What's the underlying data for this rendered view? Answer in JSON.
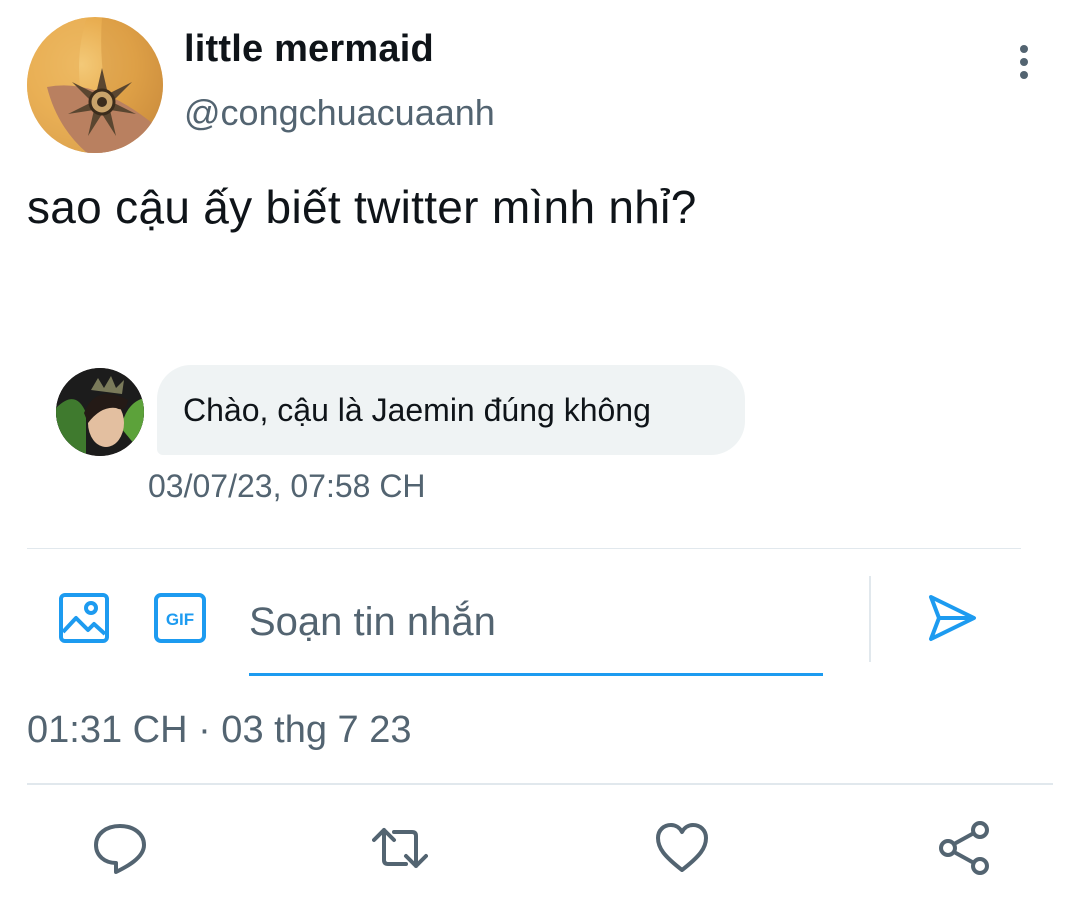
{
  "author": {
    "display_name": "little mermaid",
    "handle": "@congchuacuaanh",
    "avatar": "profile-photo"
  },
  "tweet": {
    "text": "sao cậu ấy biết twitter mình nhỉ?",
    "timestamp": "01:31 CH · 03 thg 7 23"
  },
  "embedded_dm": {
    "message": "Chào, cậu là Jaemin đúng không",
    "time": "03/07/23, 07:58 CH",
    "sender_avatar": "profile-photo"
  },
  "composer": {
    "placeholder": "Soạn tin nhắn",
    "gif_label": "GIF"
  },
  "icons": {
    "more": "more-vertical-icon",
    "image": "image-icon",
    "gif": "gif-icon",
    "send": "send-icon",
    "reply": "reply-icon",
    "retweet": "retweet-icon",
    "like": "heart-icon",
    "share": "share-icon"
  },
  "colors": {
    "accent": "#1d9bf0",
    "text": "#0f1419",
    "secondary": "#536471",
    "bubble": "#eff3f4",
    "divider": "#e1e8ed"
  }
}
